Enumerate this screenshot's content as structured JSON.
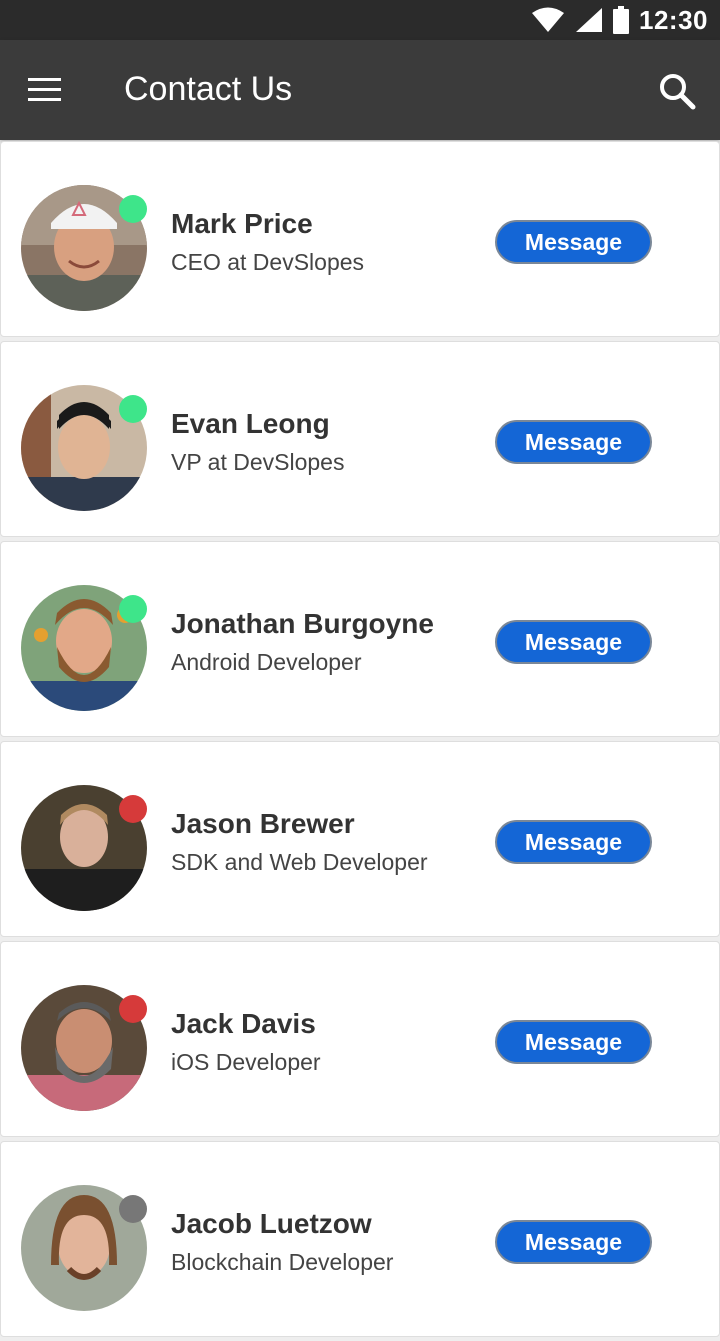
{
  "status_bar": {
    "time": "12:30",
    "icons": [
      "wifi-icon",
      "cell-signal-icon",
      "battery-icon"
    ]
  },
  "app_bar": {
    "title": "Contact Us",
    "left_icon": "menu-icon",
    "right_icon": "search-icon"
  },
  "colors": {
    "online": "#3ee58a",
    "busy": "#d63a3a",
    "offline": "#777777",
    "message_button": "#1466d6"
  },
  "contacts": [
    {
      "name": "Mark Price",
      "title": "CEO at DevSlopes",
      "status": "online",
      "button_label": "Message"
    },
    {
      "name": "Evan Leong",
      "title": "VP at DevSlopes",
      "status": "online",
      "button_label": "Message"
    },
    {
      "name": "Jonathan Burgoyne",
      "title": "Android Developer",
      "status": "online",
      "button_label": "Message"
    },
    {
      "name": "Jason Brewer",
      "title": "SDK and Web Developer",
      "status": "busy",
      "button_label": "Message"
    },
    {
      "name": "Jack Davis",
      "title": "iOS Developer",
      "status": "busy",
      "button_label": "Message"
    },
    {
      "name": "Jacob Luetzow",
      "title": "Blockchain Developer",
      "status": "offline",
      "button_label": "Message"
    }
  ]
}
